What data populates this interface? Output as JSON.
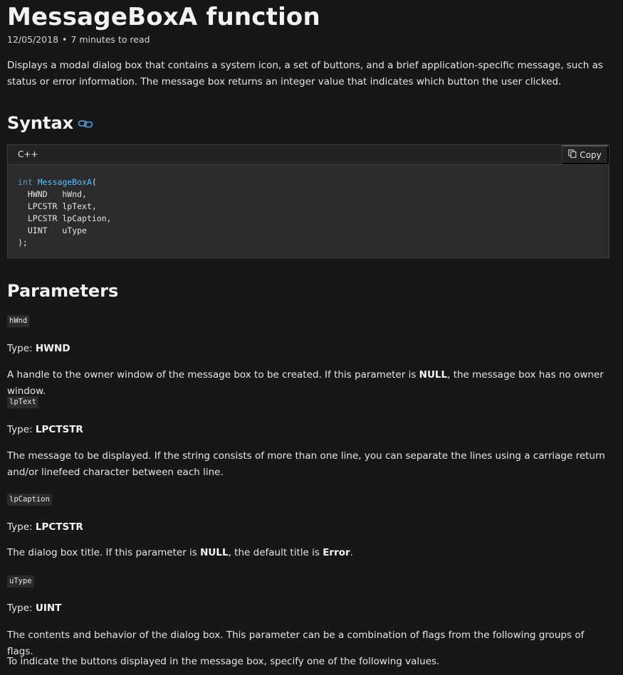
{
  "title": "MessageBoxA function",
  "meta": {
    "date": "12/05/2018",
    "separator": "•",
    "read_time": "7 minutes to read"
  },
  "intro": "Displays a modal dialog box that contains a system icon, a set of buttons, and a brief application-specific message, such as status or error information. The message box returns an integer value that indicates which button the user clicked.",
  "syntax": {
    "heading": "Syntax",
    "anchor_icon": "link-icon",
    "language": "C++",
    "copy_label": "Copy",
    "copy_icon": "copy-icon",
    "code": {
      "return_type": "int",
      "function_name": "MessageBoxA",
      "open_paren": "(",
      "params": [
        {
          "type": "HWND",
          "name": "hWnd,"
        },
        {
          "type": "LPCSTR",
          "name": "lpText,"
        },
        {
          "type": "LPCSTR",
          "name": "lpCaption,"
        },
        {
          "type": "UINT",
          "name": "uType"
        }
      ],
      "close": ");"
    }
  },
  "parameters": {
    "heading": "Parameters",
    "items": [
      {
        "name": "hWnd",
        "type_label": "Type: ",
        "type": "HWND",
        "desc_before": "A handle to the owner window of the message box to be created. If this parameter is ",
        "desc_bold": "NULL",
        "desc_after": ", the message box has no owner window."
      },
      {
        "name": "lpText",
        "type_label": "Type: ",
        "type": "LPCTSTR",
        "desc": "The message to be displayed. If the string consists of more than one line, you can separate the lines using a carriage return and/or linefeed character between each line."
      },
      {
        "name": "lpCaption",
        "type_label": "Type: ",
        "type": "LPCTSTR",
        "desc_before": "The dialog box title. If this parameter is ",
        "desc_bold": "NULL",
        "desc_middle": ", the default title is ",
        "desc_bold2": "Error",
        "desc_after": "."
      },
      {
        "name": "uType",
        "type_label": "Type: ",
        "type": "UINT",
        "desc": "The contents and behavior of the dialog box. This parameter can be a combination of flags from the following groups of flags."
      }
    ],
    "buttons_intro": "To indicate the buttons displayed in the message box, specify one of the following values."
  },
  "colors": {
    "background": "#171717",
    "code_background": "#2b2b2b",
    "keyword": "#569cd6",
    "function": "#4fc1ff",
    "link_icon": "#4fa3e0"
  }
}
